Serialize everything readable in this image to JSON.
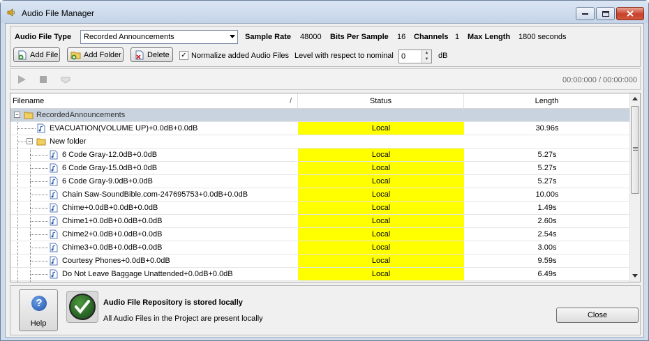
{
  "window": {
    "title": "Audio File Manager"
  },
  "settings": {
    "audio_file_type_label": "Audio File Type",
    "audio_file_type_value": "Recorded Announcements",
    "sample_rate_label": "Sample Rate",
    "sample_rate_value": "48000",
    "bits_label": "Bits Per Sample",
    "bits_value": "16",
    "channels_label": "Channels",
    "channels_value": "1",
    "max_length_label": "Max Length",
    "max_length_value": "1800 seconds"
  },
  "toolbar": {
    "add_file": "Add File",
    "add_folder": "Add Folder",
    "delete": "Delete",
    "normalize_label": "Normalize added Audio Files",
    "normalize_checked": "✓",
    "level_label": "Level with respect to nominal",
    "level_value": "0",
    "level_unit": "dB"
  },
  "player": {
    "time": "00:00:000 / 00:00:000"
  },
  "grid": {
    "columns": [
      "Filename",
      "Status",
      "Length"
    ],
    "sort_indicator": "/",
    "root": "RecordedAnnouncements",
    "rows": [
      {
        "name": "EVACUATION(VOLUME UP)+0.0dB+0.0dB",
        "status": "Local",
        "length": "30.96s"
      },
      {
        "name": "New folder",
        "status": "",
        "length": ""
      },
      {
        "name": "6 Code Gray-12.0dB+0.0dB",
        "status": "Local",
        "length": "5.27s"
      },
      {
        "name": "6 Code Gray-15.0dB+0.0dB",
        "status": "Local",
        "length": "5.27s"
      },
      {
        "name": "6 Code Gray-9.0dB+0.0dB",
        "status": "Local",
        "length": "5.27s"
      },
      {
        "name": "Chain Saw-SoundBible.com-247695753+0.0dB+0.0dB",
        "status": "Local",
        "length": "10.00s"
      },
      {
        "name": "Chime+0.0dB+0.0dB+0.0dB",
        "status": "Local",
        "length": "1.49s"
      },
      {
        "name": "Chime1+0.0dB+0.0dB+0.0dB",
        "status": "Local",
        "length": "2.60s"
      },
      {
        "name": "Chime2+0.0dB+0.0dB+0.0dB",
        "status": "Local",
        "length": "2.54s"
      },
      {
        "name": "Chime3+0.0dB+0.0dB+0.0dB",
        "status": "Local",
        "length": "3.00s"
      },
      {
        "name": "Courtesy Phones+0.0dB+0.0dB",
        "status": "Local",
        "length": "9.59s"
      },
      {
        "name": "Do Not Leave Baggage Unattended+0.0dB+0.0dB",
        "status": "Local",
        "length": "6.49s"
      }
    ]
  },
  "footer": {
    "help": "Help",
    "icon_help": "?",
    "status_title": "Audio File Repository is stored locally",
    "status_detail": "All Audio Files in the Project are present locally",
    "close": "Close"
  },
  "colors": {
    "local_status": "#ffff00",
    "selected_row": "#c8d3df"
  }
}
